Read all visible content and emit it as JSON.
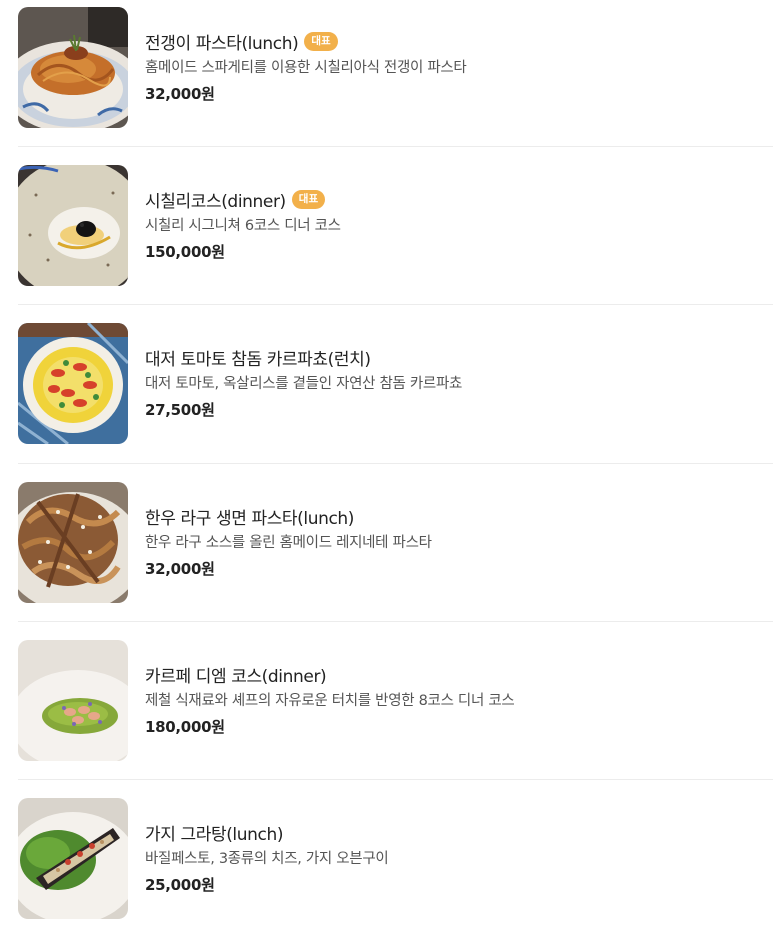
{
  "menu": {
    "items": [
      {
        "name": "전갱이 파스타(lunch)",
        "badge": "대표",
        "description": "홈메이드 스파게티를 이용한 시칠리아식 전갱이 파스타",
        "price": "32,000원"
      },
      {
        "name": "시칠리코스(dinner)",
        "badge": "대표",
        "description": "시칠리 시그니쳐 6코스 디너 코스",
        "price": "150,000원"
      },
      {
        "name": "대저 토마토 참돔 카르파쵸(런치)",
        "description": "대저 토마토, 옥살리스를 곁들인 자연산 참돔 카르파쵸",
        "price": "27,500원"
      },
      {
        "name": "한우 라구 생면 파스타(lunch)",
        "description": "한우 라구 소스를 올린 홈메이드 레지네테 파스타",
        "price": "32,000원"
      },
      {
        "name": "카르페 디엠 코스(dinner)",
        "description": "제철 식재료와 셰프의 자유로운 터치를 반영한 8코스 디너 코스",
        "price": "180,000원"
      },
      {
        "name": "가지 그라탕(lunch)",
        "description": "바질페스토, 3종류의 치즈, 가지 오븐구이",
        "price": "25,000원"
      }
    ]
  },
  "colors": {
    "badge_background": "#f2b04a",
    "divider": "#ececec",
    "title_text": "#222222",
    "description_text": "#555555"
  }
}
